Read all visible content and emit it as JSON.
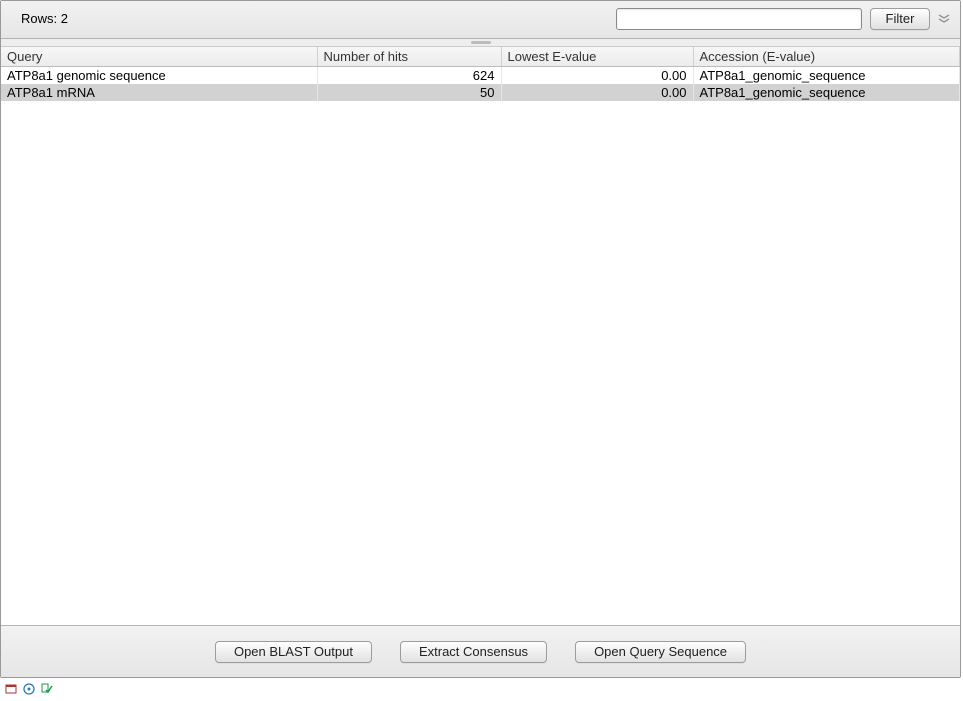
{
  "topbar": {
    "rows_label": "Rows: 2",
    "filter_placeholder": "",
    "filter_button": "Filter"
  },
  "table": {
    "headers": {
      "query": "Query",
      "hits": "Number of hits",
      "evalue": "Lowest E-value",
      "accession": "Accession (E-value)"
    },
    "rows": [
      {
        "query": "ATP8a1 genomic sequence",
        "hits": "624",
        "evalue": "0.00",
        "accession": "ATP8a1_genomic_sequence"
      },
      {
        "query": "ATP8a1 mRNA",
        "hits": "50",
        "evalue": "0.00",
        "accession": "ATP8a1_genomic_sequence"
      }
    ]
  },
  "buttons": {
    "open_blast": "Open BLAST Output",
    "extract": "Extract Consensus",
    "open_query": "Open Query Sequence"
  }
}
